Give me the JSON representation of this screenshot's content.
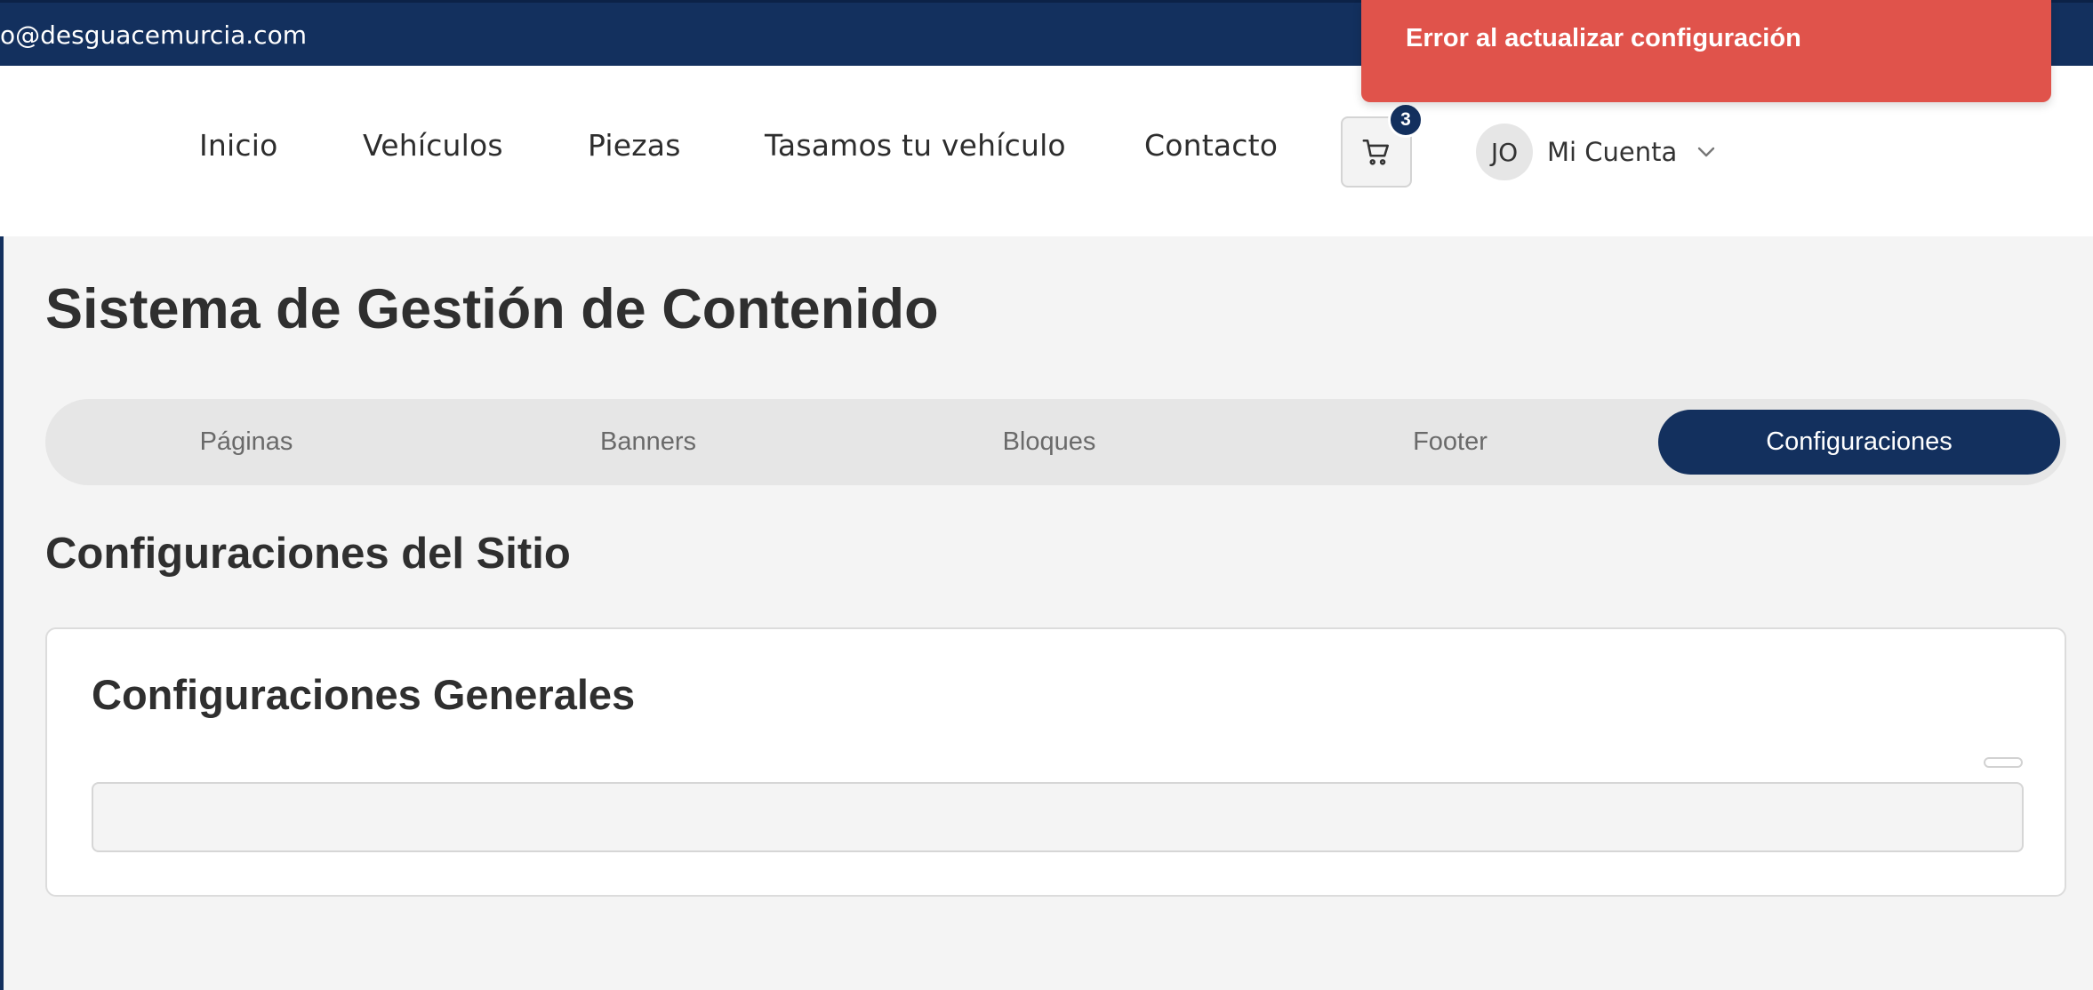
{
  "topbar": {
    "email": "o@desguacemurcia.com"
  },
  "nav": {
    "links": [
      "Inicio",
      "Vehículos",
      "Piezas",
      "Tasamos tu vehículo",
      "Contacto"
    ],
    "cart_count": "3",
    "avatar_initials": "JO",
    "account_label": "Mi Cuenta"
  },
  "toast": {
    "message": "Error al actualizar configuración",
    "color": "#e0534b"
  },
  "page": {
    "title": "Sistema de Gestión de Contenido",
    "tabs": [
      "Páginas",
      "Banners",
      "Bloques",
      "Footer",
      "Configuraciones"
    ],
    "active_tab": "Configuraciones",
    "section_title": "Configuraciones del Sitio",
    "card_title": "Configuraciones Generales",
    "input_value": ""
  },
  "colors": {
    "brand": "#13305e",
    "background": "#f4f4f4"
  },
  "icons": [
    "cart-icon",
    "chevron-down-icon"
  ]
}
